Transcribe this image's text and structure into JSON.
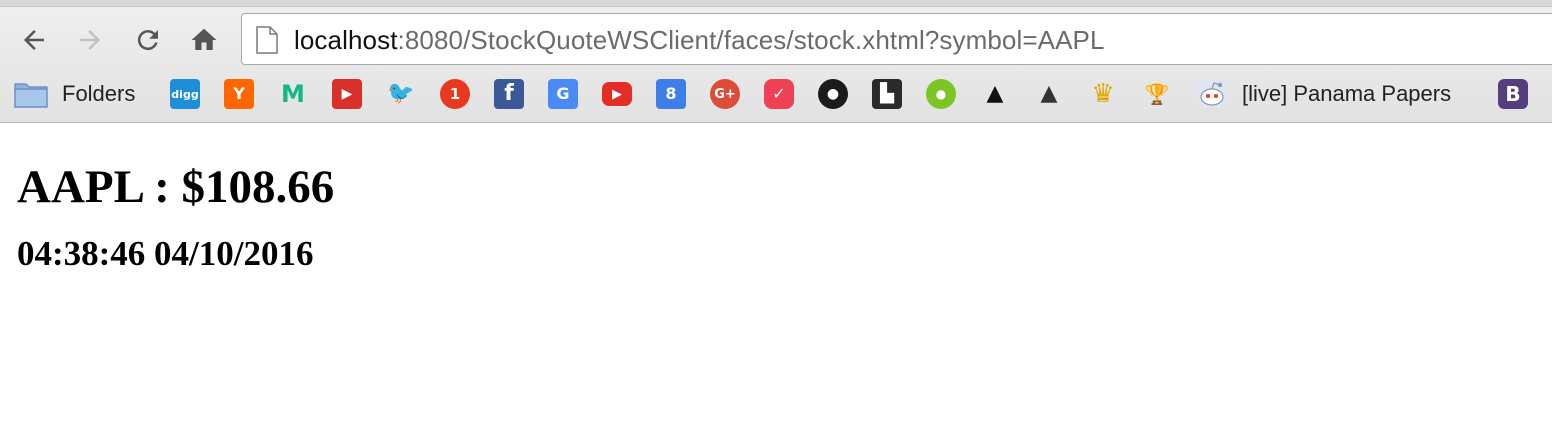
{
  "browser": {
    "url_host": "localhost",
    "url_path": ":8080/StockQuoteWSClient/faces/stock.xhtml?symbol=AAPL"
  },
  "bookmarks": [
    {
      "icon": "folder-icon",
      "label": "Folders"
    },
    {
      "icon": "digg-icon",
      "glyph": "digg",
      "color": "#1d8fd8"
    },
    {
      "icon": "hacker-news-icon",
      "glyph": "Y",
      "color": "#ff6600"
    },
    {
      "icon": "medium-icon",
      "glyph": "M",
      "color": "#12b886"
    },
    {
      "icon": "cards-icon",
      "glyph": "▶",
      "color": "#d9302c"
    },
    {
      "icon": "twitter-icon",
      "glyph": "🐦",
      "color": "#4ba3e8"
    },
    {
      "icon": "reddit-icon",
      "glyph": "1",
      "color": "#e8381f"
    },
    {
      "icon": "facebook-icon",
      "glyph": "f",
      "color": "#3b5998"
    },
    {
      "icon": "google-translate-icon",
      "glyph": "G",
      "color": "#4a8af4"
    },
    {
      "icon": "youtube-icon",
      "glyph": "▶",
      "color": "#e52d27"
    },
    {
      "icon": "calendar-icon",
      "glyph": "8",
      "color": "#3d7ee8"
    },
    {
      "icon": "google-plus-icon",
      "glyph": "G+",
      "color": "#dd4b39"
    },
    {
      "icon": "pocket-icon",
      "glyph": "✓",
      "color": "#ef4056"
    },
    {
      "icon": "github-icon",
      "glyph": "●",
      "color": "#1b1b1b"
    },
    {
      "icon": "instapaper-icon",
      "glyph": "▙",
      "color": "#2a2a2a"
    },
    {
      "icon": "duolingo-icon",
      "glyph": "●",
      "color": "#7cc524"
    },
    {
      "icon": "penguin-icon",
      "glyph": "▲",
      "color": "#111111"
    },
    {
      "icon": "penguin-mailbox-icon",
      "glyph": "▲",
      "color": "#333333"
    },
    {
      "icon": "crown-icon",
      "glyph": "♛",
      "color": "#e0a800"
    },
    {
      "icon": "trophy-icon",
      "glyph": "🏆",
      "color": "#d8a93a"
    },
    {
      "icon": "reddit-alien-icon",
      "label": "[live] Panama Papers",
      "color": "#b7c5d8"
    },
    {
      "icon": "bootstrap-icon",
      "glyph": "B",
      "color": "#563d7c"
    }
  ],
  "quote": {
    "title": "AAPL : $108.66",
    "timestamp": "04:38:46 04/10/2016"
  }
}
